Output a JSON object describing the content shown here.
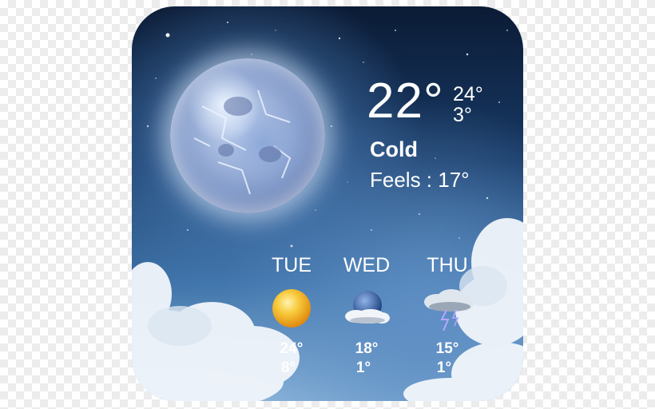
{
  "current": {
    "temperature": "22°",
    "high": "24°",
    "low": "3°",
    "condition": "Cold",
    "feels_like": "Feels : 17°",
    "icon": "moon-icon"
  },
  "forecast": [
    {
      "day": "TUE",
      "icon": "sun-icon",
      "high": "24°",
      "low": "8°"
    },
    {
      "day": "WED",
      "icon": "cloudy-night-icon",
      "high": "18°",
      "low": "1°"
    },
    {
      "day": "THU",
      "icon": "thunderstorm-icon",
      "high": "15°",
      "low": "1°"
    }
  ],
  "colors": {
    "text": "#ffffff",
    "sky_top": "#0b1b35",
    "sky_bottom": "#8fb8dc",
    "sun": "#f6b21c"
  }
}
